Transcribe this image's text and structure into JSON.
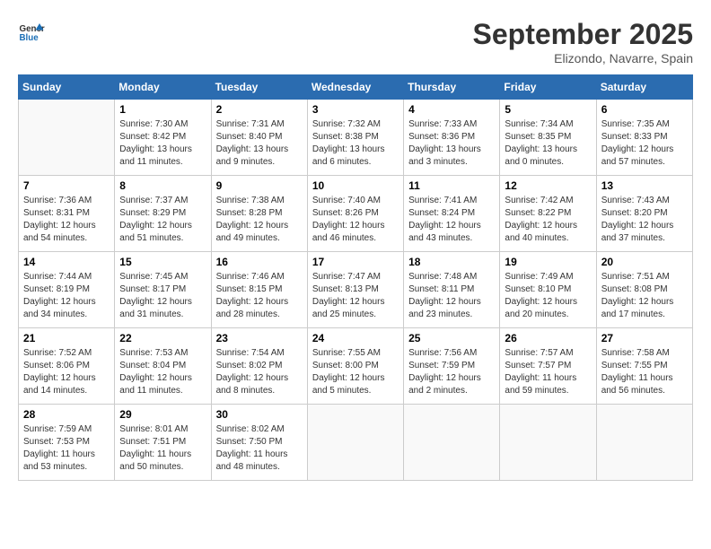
{
  "header": {
    "logo_line1": "General",
    "logo_line2": "Blue",
    "month": "September 2025",
    "location": "Elizondo, Navarre, Spain"
  },
  "weekdays": [
    "Sunday",
    "Monday",
    "Tuesday",
    "Wednesday",
    "Thursday",
    "Friday",
    "Saturday"
  ],
  "weeks": [
    [
      {
        "day": "",
        "sunrise": "",
        "sunset": "",
        "daylight": ""
      },
      {
        "day": "1",
        "sunrise": "Sunrise: 7:30 AM",
        "sunset": "Sunset: 8:42 PM",
        "daylight": "Daylight: 13 hours and 11 minutes."
      },
      {
        "day": "2",
        "sunrise": "Sunrise: 7:31 AM",
        "sunset": "Sunset: 8:40 PM",
        "daylight": "Daylight: 13 hours and 9 minutes."
      },
      {
        "day": "3",
        "sunrise": "Sunrise: 7:32 AM",
        "sunset": "Sunset: 8:38 PM",
        "daylight": "Daylight: 13 hours and 6 minutes."
      },
      {
        "day": "4",
        "sunrise": "Sunrise: 7:33 AM",
        "sunset": "Sunset: 8:36 PM",
        "daylight": "Daylight: 13 hours and 3 minutes."
      },
      {
        "day": "5",
        "sunrise": "Sunrise: 7:34 AM",
        "sunset": "Sunset: 8:35 PM",
        "daylight": "Daylight: 13 hours and 0 minutes."
      },
      {
        "day": "6",
        "sunrise": "Sunrise: 7:35 AM",
        "sunset": "Sunset: 8:33 PM",
        "daylight": "Daylight: 12 hours and 57 minutes."
      }
    ],
    [
      {
        "day": "7",
        "sunrise": "Sunrise: 7:36 AM",
        "sunset": "Sunset: 8:31 PM",
        "daylight": "Daylight: 12 hours and 54 minutes."
      },
      {
        "day": "8",
        "sunrise": "Sunrise: 7:37 AM",
        "sunset": "Sunset: 8:29 PM",
        "daylight": "Daylight: 12 hours and 51 minutes."
      },
      {
        "day": "9",
        "sunrise": "Sunrise: 7:38 AM",
        "sunset": "Sunset: 8:28 PM",
        "daylight": "Daylight: 12 hours and 49 minutes."
      },
      {
        "day": "10",
        "sunrise": "Sunrise: 7:40 AM",
        "sunset": "Sunset: 8:26 PM",
        "daylight": "Daylight: 12 hours and 46 minutes."
      },
      {
        "day": "11",
        "sunrise": "Sunrise: 7:41 AM",
        "sunset": "Sunset: 8:24 PM",
        "daylight": "Daylight: 12 hours and 43 minutes."
      },
      {
        "day": "12",
        "sunrise": "Sunrise: 7:42 AM",
        "sunset": "Sunset: 8:22 PM",
        "daylight": "Daylight: 12 hours and 40 minutes."
      },
      {
        "day": "13",
        "sunrise": "Sunrise: 7:43 AM",
        "sunset": "Sunset: 8:20 PM",
        "daylight": "Daylight: 12 hours and 37 minutes."
      }
    ],
    [
      {
        "day": "14",
        "sunrise": "Sunrise: 7:44 AM",
        "sunset": "Sunset: 8:19 PM",
        "daylight": "Daylight: 12 hours and 34 minutes."
      },
      {
        "day": "15",
        "sunrise": "Sunrise: 7:45 AM",
        "sunset": "Sunset: 8:17 PM",
        "daylight": "Daylight: 12 hours and 31 minutes."
      },
      {
        "day": "16",
        "sunrise": "Sunrise: 7:46 AM",
        "sunset": "Sunset: 8:15 PM",
        "daylight": "Daylight: 12 hours and 28 minutes."
      },
      {
        "day": "17",
        "sunrise": "Sunrise: 7:47 AM",
        "sunset": "Sunset: 8:13 PM",
        "daylight": "Daylight: 12 hours and 25 minutes."
      },
      {
        "day": "18",
        "sunrise": "Sunrise: 7:48 AM",
        "sunset": "Sunset: 8:11 PM",
        "daylight": "Daylight: 12 hours and 23 minutes."
      },
      {
        "day": "19",
        "sunrise": "Sunrise: 7:49 AM",
        "sunset": "Sunset: 8:10 PM",
        "daylight": "Daylight: 12 hours and 20 minutes."
      },
      {
        "day": "20",
        "sunrise": "Sunrise: 7:51 AM",
        "sunset": "Sunset: 8:08 PM",
        "daylight": "Daylight: 12 hours and 17 minutes."
      }
    ],
    [
      {
        "day": "21",
        "sunrise": "Sunrise: 7:52 AM",
        "sunset": "Sunset: 8:06 PM",
        "daylight": "Daylight: 12 hours and 14 minutes."
      },
      {
        "day": "22",
        "sunrise": "Sunrise: 7:53 AM",
        "sunset": "Sunset: 8:04 PM",
        "daylight": "Daylight: 12 hours and 11 minutes."
      },
      {
        "day": "23",
        "sunrise": "Sunrise: 7:54 AM",
        "sunset": "Sunset: 8:02 PM",
        "daylight": "Daylight: 12 hours and 8 minutes."
      },
      {
        "day": "24",
        "sunrise": "Sunrise: 7:55 AM",
        "sunset": "Sunset: 8:00 PM",
        "daylight": "Daylight: 12 hours and 5 minutes."
      },
      {
        "day": "25",
        "sunrise": "Sunrise: 7:56 AM",
        "sunset": "Sunset: 7:59 PM",
        "daylight": "Daylight: 12 hours and 2 minutes."
      },
      {
        "day": "26",
        "sunrise": "Sunrise: 7:57 AM",
        "sunset": "Sunset: 7:57 PM",
        "daylight": "Daylight: 11 hours and 59 minutes."
      },
      {
        "day": "27",
        "sunrise": "Sunrise: 7:58 AM",
        "sunset": "Sunset: 7:55 PM",
        "daylight": "Daylight: 11 hours and 56 minutes."
      }
    ],
    [
      {
        "day": "28",
        "sunrise": "Sunrise: 7:59 AM",
        "sunset": "Sunset: 7:53 PM",
        "daylight": "Daylight: 11 hours and 53 minutes."
      },
      {
        "day": "29",
        "sunrise": "Sunrise: 8:01 AM",
        "sunset": "Sunset: 7:51 PM",
        "daylight": "Daylight: 11 hours and 50 minutes."
      },
      {
        "day": "30",
        "sunrise": "Sunrise: 8:02 AM",
        "sunset": "Sunset: 7:50 PM",
        "daylight": "Daylight: 11 hours and 48 minutes."
      },
      {
        "day": "",
        "sunrise": "",
        "sunset": "",
        "daylight": ""
      },
      {
        "day": "",
        "sunrise": "",
        "sunset": "",
        "daylight": ""
      },
      {
        "day": "",
        "sunrise": "",
        "sunset": "",
        "daylight": ""
      },
      {
        "day": "",
        "sunrise": "",
        "sunset": "",
        "daylight": ""
      }
    ]
  ]
}
